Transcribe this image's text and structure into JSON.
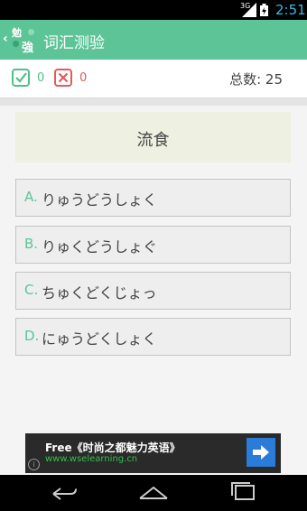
{
  "status_bar": {
    "network": "3G",
    "time": "2:51"
  },
  "app_bar": {
    "title": "词汇测验",
    "logo_char_top": "勉",
    "logo_char_bottom": "強"
  },
  "score": {
    "correct_count": "0",
    "wrong_count": "0",
    "total_label": "总数: 25"
  },
  "question": {
    "word": "流食"
  },
  "options": [
    {
      "letter": "A.",
      "text": "りゅうどうしょく"
    },
    {
      "letter": "B.",
      "text": "りゅくどうしょぐ"
    },
    {
      "letter": "C.",
      "text": "ちゅくどくじょっ"
    },
    {
      "letter": "D.",
      "text": "にゅうどくしょく"
    }
  ],
  "ad": {
    "title": "Free《时尚之都魅力英语》",
    "url": "www.wselearning.cn",
    "info": "i"
  },
  "colors": {
    "accent": "#5cc497",
    "correct": "#4fbf8a",
    "wrong": "#e25b5b",
    "question_bg": "#eef0e1",
    "ad_button": "#2b7bd8"
  }
}
